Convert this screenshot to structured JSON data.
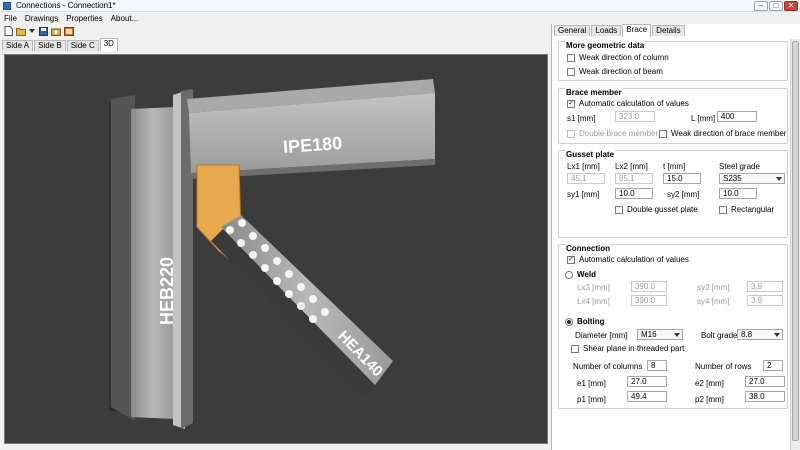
{
  "window": {
    "title": "Connections - Connection1*"
  },
  "menu": [
    "File",
    "Drawings",
    "Properties",
    "About..."
  ],
  "view_tabs": [
    "Side A",
    "Side B",
    "Side C",
    "3D"
  ],
  "panel_tabs": [
    "General",
    "Loads",
    "Brace",
    "Details"
  ],
  "viewport_labels": {
    "column": "HEB220",
    "beam": "IPE180",
    "brace": "HEA140"
  },
  "geometric": {
    "title": "More geometric data",
    "weak_column": "Weak direction of column",
    "weak_beam": "Weak direction of beam"
  },
  "brace": {
    "title": "Brace member",
    "auto": "Automatic calculation of values",
    "s1_label": "s1 [mm]",
    "s1_value": "323.0",
    "l_label": "L [mm]",
    "l_value": "400",
    "double": "Double brace member",
    "weak": "Weak direction of brace member"
  },
  "gusset": {
    "title": "Gusset plate",
    "lx1_label": "Lx1 [mm]",
    "lx1_value": "45.1",
    "lx2_label": "Lx2 [mm]",
    "lx2_value": "85.1",
    "t_label": "t [mm]",
    "t_value": "15.0",
    "grade_label": "Steel grade",
    "grade_value": "S235",
    "sy1_label": "sy1 [mm]",
    "sy1_value": "10.0",
    "sy2_label": "sy2 [mm]",
    "sy2_value": "10.0",
    "double": "Double gusset plate",
    "rect": "Rectangular"
  },
  "connection": {
    "title": "Connection",
    "auto": "Automatic calculation of values",
    "weld": "Weld",
    "lx3_label": "Lx3 [mm]",
    "lx3_value": "390.0",
    "sy3_label": "sy3 [mm]",
    "sy3_value": "3.9",
    "lx4_label": "Lx4 [mm]",
    "lx4_value": "390.0",
    "sy4_label": "sy4 [mm]",
    "sy4_value": "3.9",
    "bolting": "Bolting",
    "diameter_label": "Diameter [mm]",
    "diameter_value": "M16",
    "grade_label": "Bolt grade",
    "grade_value": "8.8",
    "shear": "Shear plane in threaded part",
    "cols_label": "Number of columns",
    "cols_value": "8",
    "rows_label": "Number of rows",
    "rows_value": "2",
    "e1_label": "e1 [mm]",
    "e1_value": "27.0",
    "e2_label": "e2 [mm]",
    "e2_value": "27.0",
    "p1_label": "p1 [mm]",
    "p1_value": "49.4",
    "p2_label": "p2 [mm]",
    "p2_value": "38.0"
  }
}
